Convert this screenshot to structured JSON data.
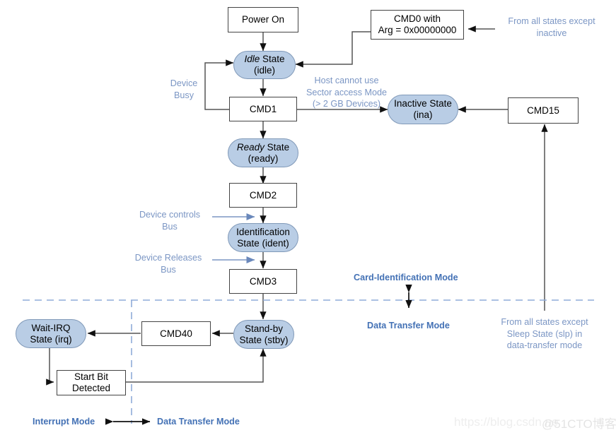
{
  "diagram": {
    "title": "eMMC Device State Diagram",
    "colors": {
      "state_fill": "#b9cde5",
      "state_border": "#8099b8",
      "box_border": "#444444",
      "note_text": "#7b96c4",
      "mode_label": "#4371b5",
      "edge": "#555555",
      "boundary_dash": "#8fabd8"
    },
    "nodes": [
      {
        "id": "power-on",
        "kind": "box",
        "lines": [
          "Power On"
        ]
      },
      {
        "id": "cmd0",
        "kind": "box",
        "lines": [
          "CMD0 with",
          "Arg = 0x00000000"
        ]
      },
      {
        "id": "idle",
        "kind": "state",
        "lines": [
          "Idle State",
          "(idle)"
        ],
        "italic_first_word": "Idle"
      },
      {
        "id": "cmd1",
        "kind": "box",
        "lines": [
          "CMD1"
        ]
      },
      {
        "id": "inactive",
        "kind": "state",
        "lines": [
          "Inactive State",
          "(ina)"
        ]
      },
      {
        "id": "cmd15",
        "kind": "box",
        "lines": [
          "CMD15"
        ]
      },
      {
        "id": "ready",
        "kind": "state",
        "lines": [
          "Ready State",
          "(ready)"
        ],
        "italic_first_word": "Ready"
      },
      {
        "id": "cmd2",
        "kind": "box",
        "lines": [
          "CMD2"
        ]
      },
      {
        "id": "identification",
        "kind": "state",
        "lines": [
          "Identification",
          "State (ident)"
        ]
      },
      {
        "id": "cmd3",
        "kind": "box",
        "lines": [
          "CMD3"
        ]
      },
      {
        "id": "standby",
        "kind": "state",
        "lines": [
          "Stand-by",
          "State (stby)"
        ]
      },
      {
        "id": "cmd40",
        "kind": "box",
        "lines": [
          "CMD40"
        ]
      },
      {
        "id": "waitirq",
        "kind": "state",
        "lines": [
          "Wait-IRQ",
          "State (irq)"
        ]
      },
      {
        "id": "startbit",
        "kind": "box",
        "lines": [
          "Start Bit",
          "Detected"
        ]
      }
    ],
    "notes": [
      {
        "id": "from-all-except-inactive",
        "lines": [
          "From all states except",
          "inactive"
        ]
      },
      {
        "id": "device-busy",
        "lines": [
          "Device",
          "Busy"
        ]
      },
      {
        "id": "host-cannot-use",
        "lines": [
          "Host cannot use",
          "Sector access Mode",
          "(> 2 GB Devices)"
        ]
      },
      {
        "id": "device-controls-bus",
        "lines": [
          "Device controls",
          "Bus"
        ]
      },
      {
        "id": "device-releases-bus",
        "lines": [
          "Device Releases",
          "Bus"
        ]
      },
      {
        "id": "from-all-except-sleep",
        "lines": [
          "From all states except",
          "Sleep State (slp) in",
          "data-transfer mode"
        ]
      }
    ],
    "mode_labels": [
      {
        "id": "card-identification-mode",
        "text": "Card-Identification Mode"
      },
      {
        "id": "data-transfer-mode-right",
        "text": "Data Transfer Mode"
      },
      {
        "id": "interrupt-mode",
        "text": "Interrupt Mode"
      },
      {
        "id": "data-transfer-mode-bottom",
        "text": "Data Transfer Mode"
      }
    ],
    "watermark": {
      "url_text": "https://blog.csdn.ne",
      "brand_text": "@51CTO博客"
    }
  }
}
